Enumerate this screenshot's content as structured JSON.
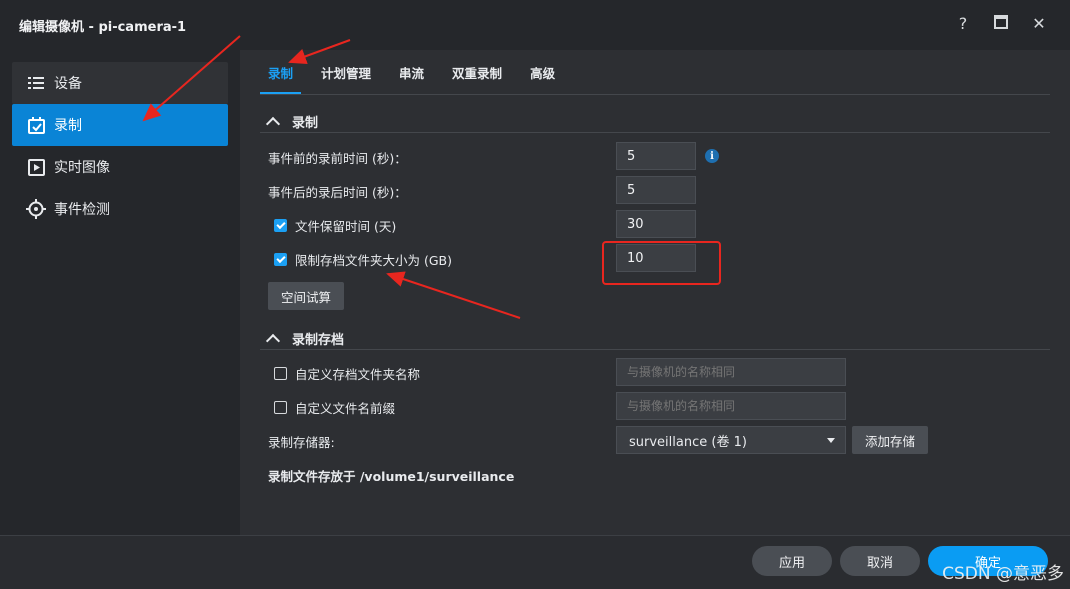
{
  "window": {
    "title": "编辑摄像机 - pi-camera-1",
    "help_icon": "?",
    "close_icon": "✕"
  },
  "sidebar": {
    "items": [
      {
        "label": "设备",
        "icon": "list-icon"
      },
      {
        "label": "录制",
        "icon": "calendar-check-icon",
        "active": true
      },
      {
        "label": "实时图像",
        "icon": "play-square-icon"
      },
      {
        "label": "事件检测",
        "icon": "crosshair-icon"
      }
    ]
  },
  "tabs": [
    {
      "label": "录制",
      "active": true
    },
    {
      "label": "计划管理"
    },
    {
      "label": "串流"
    },
    {
      "label": "双重录制"
    },
    {
      "label": "高级"
    }
  ],
  "recording": {
    "section_title": "录制",
    "pre_event_label": "事件前的录前时间 (秒)：",
    "pre_event_value": "5",
    "post_event_label": "事件后的录后时间 (秒)：",
    "post_event_value": "5",
    "retention_label": "文件保留时间 (天)",
    "retention_checked": true,
    "retention_value": "30",
    "limit_label": "限制存档文件夹大小为 (GB)",
    "limit_checked": true,
    "limit_value": "10",
    "estimate_button": "空间试算"
  },
  "archive": {
    "section_title": "录制存档",
    "custom_folder_label": "自定义存档文件夹名称",
    "custom_folder_placeholder": "与摄像机的名称相同",
    "custom_prefix_label": "自定义文件名前缀",
    "custom_prefix_placeholder": "与摄像机的名称相同",
    "storage_label": "录制存储器:",
    "storage_value": "surveillance (卷 1)",
    "add_storage_button": "添加存储",
    "path_text": "录制文件存放于 /volume1/surveillance"
  },
  "footer": {
    "apply": "应用",
    "cancel": "取消",
    "ok": "确定"
  },
  "watermark": "CSDN @意恶多",
  "colors": {
    "accent": "#1ba0f4",
    "annotation_red": "#e8261f"
  }
}
